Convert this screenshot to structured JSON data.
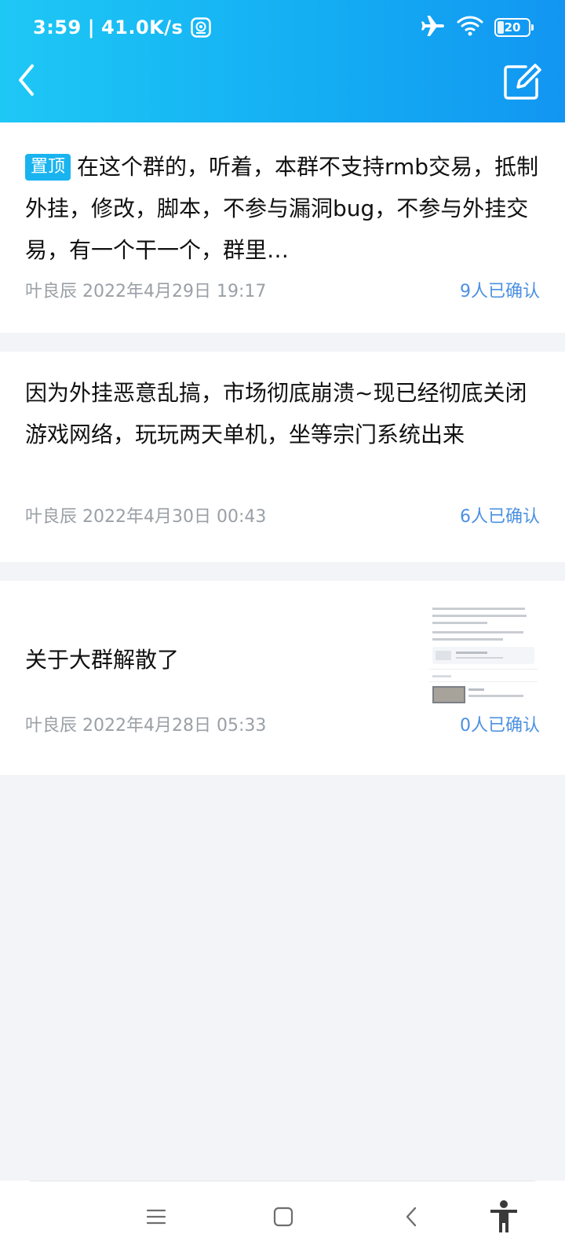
{
  "status_bar": {
    "time": "3:59",
    "separator": "|",
    "speed": "41.0K/s",
    "battery_level": "20",
    "icons": [
      "vpn-app-icon",
      "airplane-icon",
      "wifi-icon",
      "battery-icon"
    ]
  },
  "header": {
    "back_icon": "chevron-left-icon",
    "edit_icon": "edit-icon",
    "background_colors": [
      "#1ec8f5",
      "#1296f2"
    ]
  },
  "announcements": [
    {
      "pinned": true,
      "pin_label": "置顶",
      "text": "在这个群的，听着，本群不支持rmb交易，抵制外挂，修改，脚本，不参与漏洞bug，不参与外挂交易，有一个干一个，群里…",
      "author": "叶良辰",
      "time": "2022年4月29日 19:17",
      "confirm": "9人已确认"
    },
    {
      "pinned": false,
      "text": "因为外挂恶意乱搞，市场彻底崩溃~现已经彻底关闭游戏网络，玩玩两天单机，坐等宗门系统出来",
      "author": "叶良辰",
      "time": "2022年4月30日 00:43",
      "confirm": "6人已确认"
    },
    {
      "pinned": false,
      "text": "关于大群解散了",
      "author": "叶良辰",
      "time": "2022年4月28日 05:33",
      "confirm": "0人已确认",
      "has_thumbnail": true
    }
  ],
  "nav_bar": {
    "icons": [
      "menu-icon",
      "home-square-icon",
      "back-triangle-icon",
      "accessibility-icon"
    ]
  },
  "colors": {
    "accent": "#19b4ef",
    "confirm_text": "#4a90e2",
    "meta_text": "#9aa0a6",
    "background": "#f2f4f8"
  }
}
